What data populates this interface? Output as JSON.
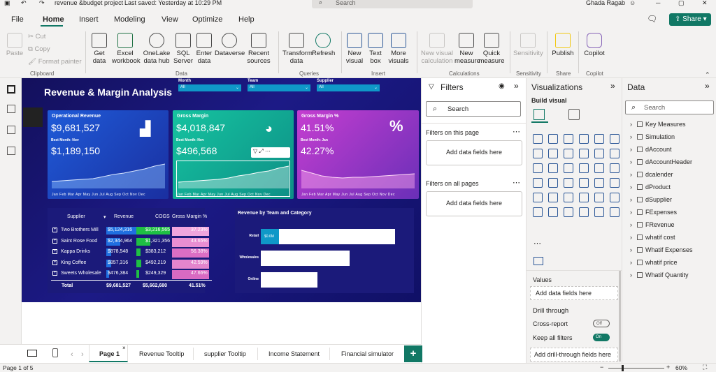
{
  "titlebar": {
    "file_name": "revenue &budget project",
    "saved": "Last saved: Yesterday at 10:29 PM",
    "search": "Search",
    "user": "Ghada Ragab"
  },
  "menu": [
    "File",
    "Home",
    "Insert",
    "Modeling",
    "View",
    "Optimize",
    "Help"
  ],
  "share": "Share",
  "ribbon": {
    "clipboard": {
      "paste": "Paste",
      "cut": "Cut",
      "copy": "Copy",
      "format_painter": "Format painter",
      "group": "Clipboard"
    },
    "data": {
      "items": [
        "Get data",
        "Excel workbook",
        "OneLake data hub",
        "SQL Server",
        "Enter data",
        "Dataverse",
        "Recent sources"
      ],
      "group": "Data"
    },
    "queries": {
      "items": [
        "Transform data",
        "Refresh"
      ],
      "group": "Queries"
    },
    "insert": {
      "items": [
        "New visual",
        "Text box",
        "More visuals"
      ],
      "group": "Insert"
    },
    "calculations": {
      "items": [
        "New visual calculation",
        "New measure",
        "Quick measure"
      ],
      "group": "Calculations"
    },
    "sensitivity": {
      "items": [
        "Sensitivity"
      ],
      "group": "Sensitivity"
    },
    "share": {
      "items": [
        "Publish"
      ],
      "group": "Share"
    },
    "copilot": {
      "items": [
        "Copilot"
      ],
      "group": "Copilot"
    }
  },
  "report": {
    "title": "Revenue & Margin Analysis",
    "slicers": [
      {
        "label": "Month",
        "value": "All"
      },
      {
        "label": "Team",
        "value": "All"
      },
      {
        "label": "Supplier",
        "value": "All"
      }
    ],
    "cards": [
      {
        "title": "Operational Revenue",
        "value": "$9,681,527",
        "sub": "Best Month: Nov",
        "sub_value": "$1,189,150"
      },
      {
        "title": "Gross Margin",
        "value": "$4,018,847",
        "sub": "Best Month: Nov",
        "sub_value": "$496,568"
      },
      {
        "title": "Gross Margin %",
        "value": "41.51%",
        "sub": "Best Month: Jan",
        "sub_value": "42.27%"
      }
    ],
    "months": "Jan Feb Mar Apr May Jun Jul Aug Sep Oct Nov Dec",
    "matrix": {
      "headers": [
        "Supplier",
        "Revenue",
        "COGS",
        "Gross Margin %"
      ],
      "rows": [
        {
          "name": "Two Brothers Mill",
          "revenue": "$5,124,316",
          "cogs": "$3,216,565",
          "gm": "37.23%",
          "rev_frac": 1.0,
          "cogs_frac": 1.0
        },
        {
          "name": "Saint Rose Food",
          "revenue": "$2,344,964",
          "cogs": "$1,321,356",
          "gm": "43.65%",
          "rev_frac": 0.46,
          "cogs_frac": 0.41
        },
        {
          "name": "Kappa Drinks",
          "revenue": "$878,548",
          "cogs": "$383,212",
          "gm": "56.38%",
          "rev_frac": 0.17,
          "cogs_frac": 0.12
        },
        {
          "name": "King Coffee",
          "revenue": "$857,316",
          "cogs": "$492,219",
          "gm": "42.59%",
          "rev_frac": 0.17,
          "cogs_frac": 0.15
        },
        {
          "name": "Sweets Wholesale",
          "revenue": "$476,384",
          "cogs": "$249,329",
          "gm": "47.66%",
          "rev_frac": 0.09,
          "cogs_frac": 0.08
        }
      ],
      "total": {
        "label": "Total",
        "revenue": "$9,681,527",
        "cogs": "$5,662,680",
        "gm": "41.51%"
      }
    },
    "team_chart": {
      "title": "Revenue by Team and Category",
      "bars": [
        {
          "label": "Retail",
          "value_label": "$0.6M",
          "frac": 1.0
        },
        {
          "label": "Wholesales",
          "value_label": "",
          "frac": 0.66
        },
        {
          "label": "Online",
          "value_label": "",
          "frac": 0.42
        }
      ]
    }
  },
  "filters": {
    "title": "Filters",
    "search": "Search",
    "on_page": "Filters on this page",
    "on_all": "Filters on all pages",
    "add": "Add data fields here"
  },
  "viz": {
    "title": "Visualizations",
    "build": "Build visual",
    "values": "Values",
    "add": "Add data fields here",
    "drill": "Drill through",
    "cross": "Cross-report",
    "cross_state": "Off",
    "keep": "Keep all filters",
    "keep_state": "On",
    "add_drill": "Add drill-through fields here"
  },
  "data": {
    "title": "Data",
    "search": "Search",
    "tables": [
      "Key Measures",
      "Simulation",
      "dAccount",
      "dAccountHeader",
      "dcalender",
      "dProduct",
      "dSupplier",
      "FExpenses",
      "FRevenue",
      "whatif cost",
      "Whatif Expenses",
      "whatif price",
      "Whatif Quantity"
    ]
  },
  "tabs": [
    "Page 1",
    "Revenue Tooltip",
    "supplier Tooltip",
    "Income Statement",
    "Financial simulator"
  ],
  "status": {
    "page": "Page 1 of 5",
    "zoom": "60%"
  }
}
